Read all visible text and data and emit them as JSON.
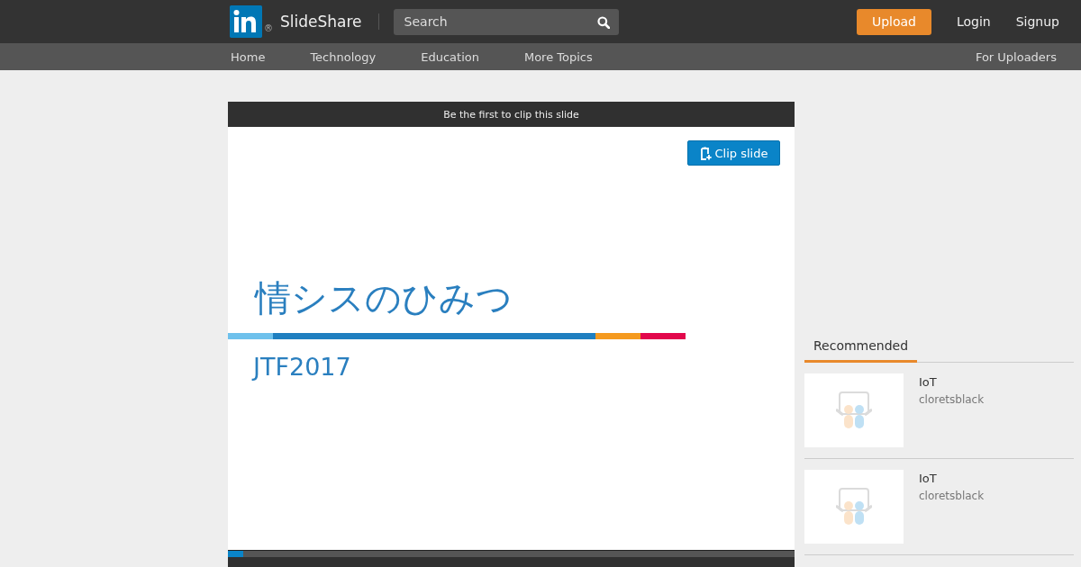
{
  "header": {
    "brand": "SlideShare",
    "registered": "®",
    "search": {
      "placeholder": "Search"
    },
    "buttons": [
      "Upload",
      "Login",
      "Signup"
    ]
  },
  "nav": {
    "items": [
      "Home",
      "Technology",
      "Education",
      "More Topics"
    ],
    "right": "For Uploaders"
  },
  "player": {
    "banner": "Be the first to clip this slide",
    "clip_button": "Clip slide",
    "slide": {
      "title": "情シスのひみつ",
      "subtitle": "JTF2017"
    },
    "progress": {
      "level": 0.027
    }
  },
  "sidebar": {
    "tabs": [
      {
        "label": "Recommended",
        "selected": true
      }
    ],
    "items": [
      {
        "title": "IoT",
        "author": "cloretsblack"
      },
      {
        "title": "IoT",
        "author": "cloretsblack"
      }
    ]
  }
}
